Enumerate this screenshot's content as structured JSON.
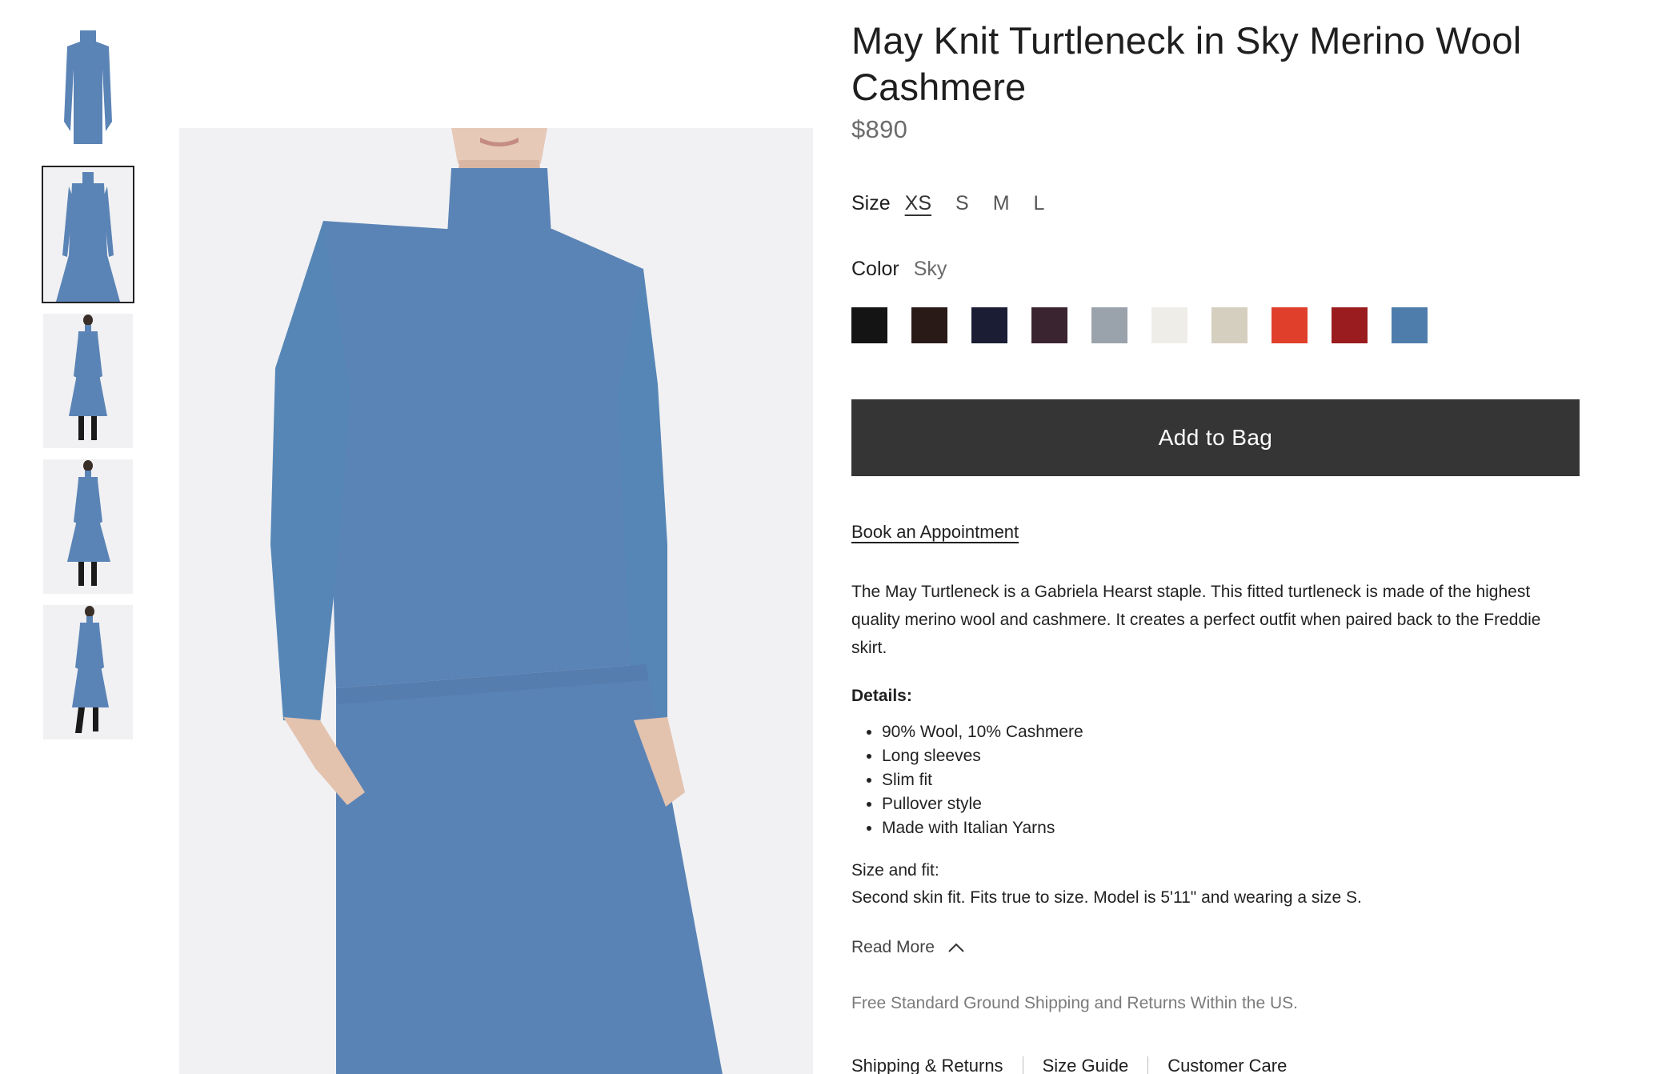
{
  "product": {
    "title": "May Knit Turtleneck in Sky Merino Wool Cashmere",
    "price": "$890"
  },
  "size": {
    "label": "Size",
    "options": [
      "XS",
      "S",
      "M",
      "L"
    ],
    "selected": "XS"
  },
  "color": {
    "label": "Color",
    "value": "Sky",
    "swatches": [
      "#141414",
      "#2a1a17",
      "#1a1d33",
      "#3a2430",
      "#9aa2ab",
      "#efede8",
      "#d5cfc0",
      "#e0402b",
      "#9a1c1e",
      "#4e7dab"
    ]
  },
  "actions": {
    "add_to_bag": "Add to Bag",
    "book_appointment": "Book an Appointment",
    "read_more": "Read More"
  },
  "description": "The May Turtleneck is a Gabriela Hearst staple. This fitted turtleneck is made of the highest quality merino wool and cashmere. It creates a perfect outfit when paired back to the Freddie skirt.",
  "details": {
    "label": "Details:",
    "items": [
      "90% Wool, 10% Cashmere",
      "Long sleeves",
      "Slim fit",
      "Pullover style",
      "Made with Italian Yarns"
    ]
  },
  "size_fit": {
    "label": "Size and fit:",
    "text": "Second skin fit. Fits true to size. Model is 5'11\" and wearing a size S."
  },
  "shipping_note": "Free Standard Ground Shipping and Returns Within the US.",
  "footer_links": [
    "Shipping & Returns",
    "Size Guide",
    "Customer Care"
  ],
  "thumbnails": {
    "count": 5,
    "selected_index": 1
  },
  "garment_color": "#5b84b6"
}
